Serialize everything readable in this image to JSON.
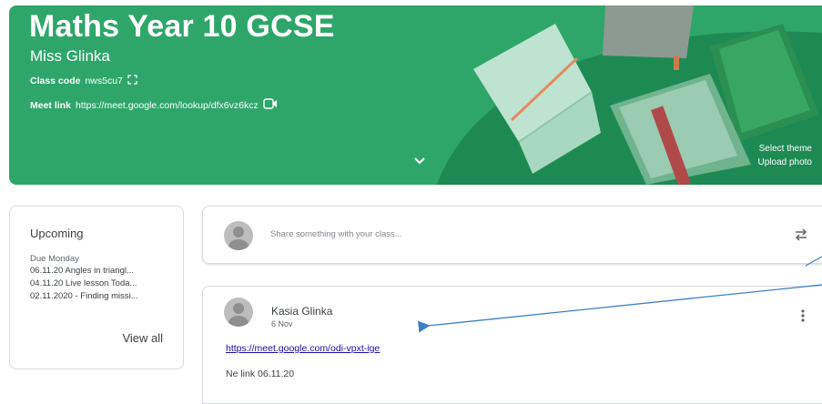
{
  "class": {
    "title": "Maths Year 10 GCSE",
    "teacher": "Miss Glinka",
    "code_label": "Class code",
    "code_value": "nws5cu7",
    "meet_label": "Meet link",
    "meet_value": "https://meet.google.com/lookup/dfx6vz6kcz",
    "select_theme": "Select theme",
    "upload_photo": "Upload photo"
  },
  "upcoming": {
    "title": "Upcoming",
    "due": "Due Monday",
    "items": [
      "06.11.20 Angles in triangl...",
      "04.11.20 Live lesson Toda...",
      "02.11.2020 - Finding missi..."
    ],
    "view_all": "View all"
  },
  "share": {
    "placeholder": "Share something with your class..."
  },
  "post": {
    "author": "Kasia Glinka",
    "date": "6 Nov",
    "link": "https://meet.google.com/odi-vpxt-ige",
    "body": "Ne link 06.11.20"
  },
  "colors": {
    "banner": "#2ea66a",
    "banner_dark": "#1e8a53",
    "link": "#1a0dab",
    "annotation_arrow": "#3d7fc4"
  },
  "icons": [
    "fullscreen-icon",
    "video-camera-icon",
    "chevron-down-icon",
    "repost-icon",
    "more-vert-icon",
    "avatar"
  ]
}
